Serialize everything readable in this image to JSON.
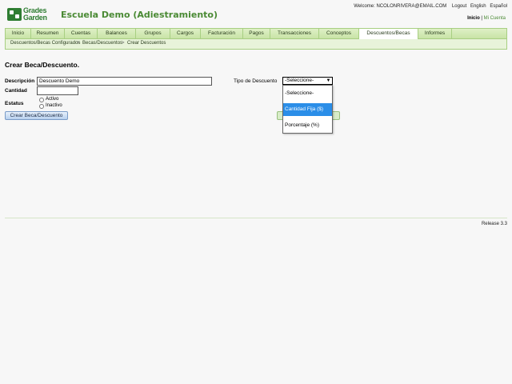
{
  "header": {
    "logo_line1": "Grades",
    "logo_line2": "Garden",
    "school_name": "Escuela Demo (Adiestramiento)",
    "welcome": "Welcome: NCOLONRIVERA@EMAIL.COM",
    "logout": "Logout",
    "english": "English",
    "espanol": "Español",
    "inicio": "Inicio",
    "separator": "|",
    "mi_cuenta": "Mi Cuenta"
  },
  "nav": {
    "items": [
      "Inicio",
      "Resumen",
      "Cuentas",
      "Balances",
      "Grupos",
      "Cargos",
      "Facturación",
      "Pagos",
      "Transacciones",
      "Conceptos",
      "Descuentos/Becas",
      "Informes"
    ],
    "active": "Descuentos/Becas"
  },
  "breadcrumb": {
    "items": [
      "Descuentos/Becas Configurados",
      "Becas/Descuentos",
      "Crear Descuentos"
    ],
    "sep": ">"
  },
  "form": {
    "title": "Crear Beca/Descuento.",
    "descripcion_label": "Descripción",
    "descripcion_value": "Descuento Demo",
    "cantidad_label": "Cantidad",
    "cantidad_value": "",
    "estatus_label": "Estatus",
    "radio_activo": "Activo",
    "radio_inactivo": "Inactivo",
    "submit_label": "Crear Beca/Descuento",
    "tipo_label": "Tipo de Descuento",
    "tipo_selected": "-Seleccione-",
    "tipo_options": [
      "-Seleccione-",
      "Cantidad Fija ($)",
      "Porcentaje (%)"
    ],
    "tipo_highlighted": "Cantidad Fija ($)"
  },
  "footer": {
    "release": "Release 3.3"
  },
  "colors": {
    "brand_green": "#4a8a34",
    "nav_bg": "#c8e3a6",
    "highlight_blue": "#2b8ee8"
  }
}
